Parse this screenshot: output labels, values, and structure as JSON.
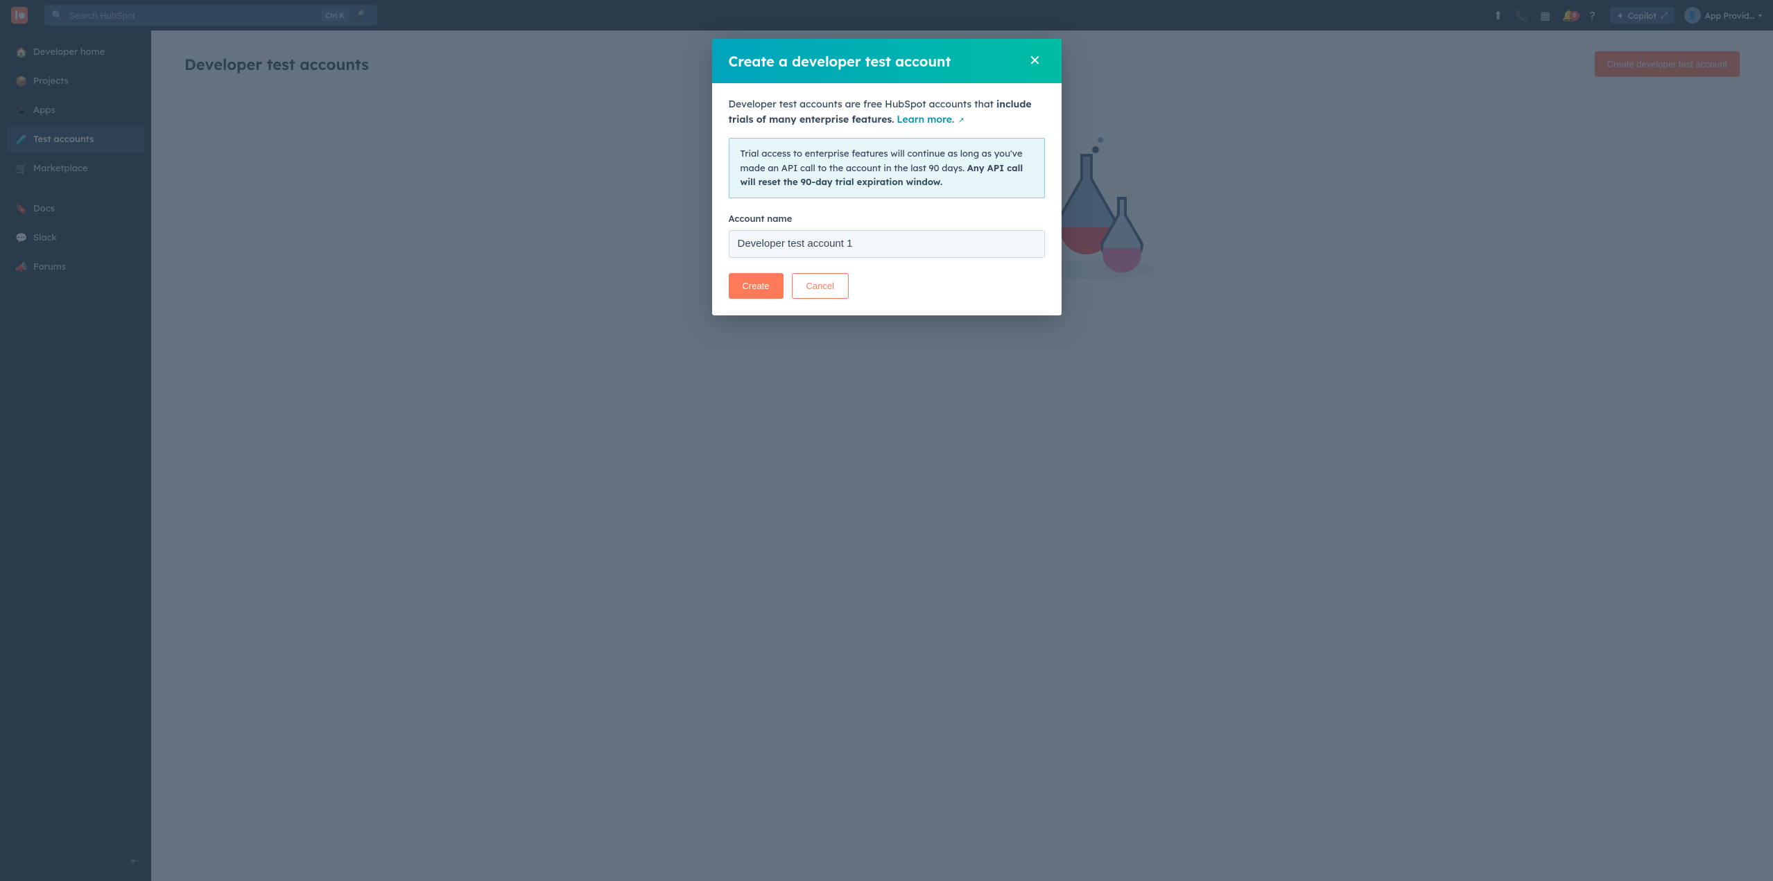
{
  "topnav": {
    "search_placeholder": "Search HubSpot",
    "shortcut_key": "Ctrl K",
    "notif_count": "8",
    "copilot_label": "Copilot",
    "account_name": "App Provid…"
  },
  "sidebar": {
    "items": [
      {
        "icon": "🏠",
        "label": "Developer home"
      },
      {
        "icon": "📦",
        "label": "Projects"
      },
      {
        "icon": "📱",
        "label": "Apps"
      },
      {
        "icon": "🧪",
        "label": "Test accounts"
      },
      {
        "icon": "🛒",
        "label": "Marketplace"
      },
      {
        "icon": "🔖",
        "label": "Docs"
      },
      {
        "icon": "💬",
        "label": "Slack"
      },
      {
        "icon": "📣",
        "label": "Forums"
      }
    ],
    "active_index": 3
  },
  "page": {
    "title": "Developer test accounts",
    "create_button": "Create developer test account"
  },
  "modal": {
    "title": "Create a developer test account",
    "intro_prefix": "Developer test accounts are free HubSpot accounts that ",
    "intro_bold": "include trials of many enterprise features",
    "intro_suffix": ". ",
    "learn_more": "Learn more.",
    "callout_prefix": "Trial access to enterprise features will continue as long as you've made an API call to the account in the last 90 days. ",
    "callout_bold": "Any API call will reset the 90-day trial expiration window.",
    "field_label": "Account name",
    "field_value": "Developer test account 1",
    "create_label": "Create",
    "cancel_label": "Cancel"
  }
}
